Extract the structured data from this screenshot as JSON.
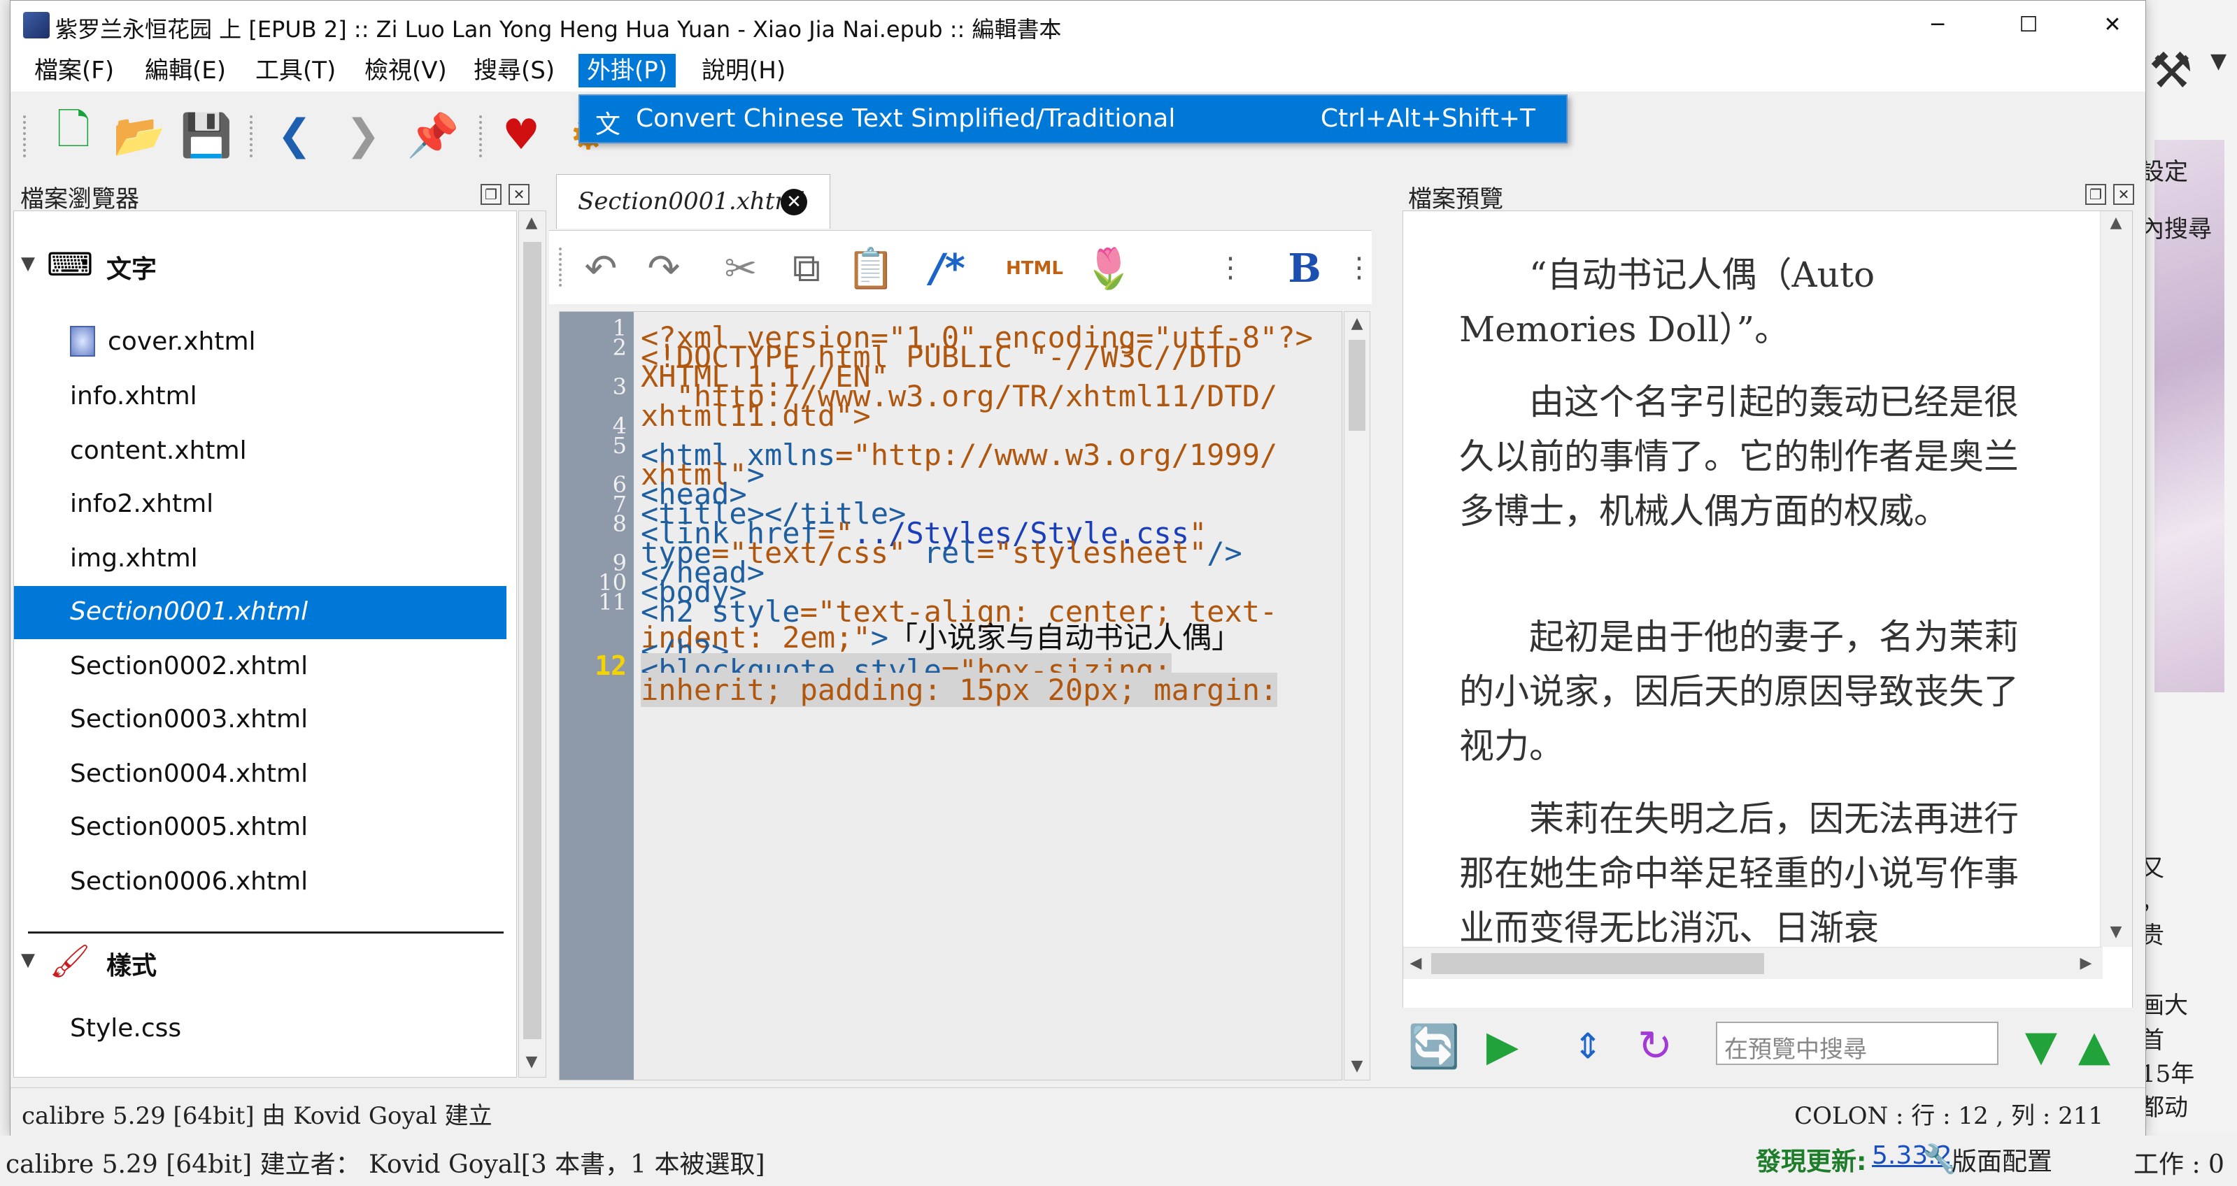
{
  "window": {
    "title": "紫罗兰永恒花园 上 [EPUB 2] :: Zi Luo Lan Yong Heng Hua Yuan - Xiao Jia Nai.epub :: 編輯書本",
    "minimize": "─",
    "maximize": "☐",
    "close": "✕"
  },
  "menu": [
    "檔案(F)",
    "編輯(E)",
    "工具(T)",
    "檢視(V)",
    "搜尋(S)",
    "外掛(P)",
    "說明(H)"
  ],
  "dropdown": {
    "icon": "文",
    "label": "Convert Chinese Text Simplified/Traditional",
    "shortcut": "Ctrl+Alt+Shift+T"
  },
  "toolbar_icons": [
    "new-file-icon",
    "open-folder-icon",
    "save-icon",
    "back-icon",
    "forward-icon",
    "pin-icon",
    "heart-icon",
    "settings-icon"
  ],
  "file_browser": {
    "title": "檔案瀏覽器",
    "sections": [
      {
        "label": "文字",
        "icon": "text-keyboard-icon"
      },
      {
        "label": "樣式",
        "icon": "paintbrush-icon"
      }
    ],
    "files": [
      "cover.xhtml",
      "info.xhtml",
      "content.xhtml",
      "info2.xhtml",
      "img.xhtml",
      "Section0001.xhtml",
      "Section0002.xhtml",
      "Section0003.xhtml",
      "Section0004.xhtml",
      "Section0005.xhtml",
      "Section0006.xhtml"
    ],
    "selected": "Section0001.xhtml",
    "styles": [
      "Style.css"
    ]
  },
  "editor": {
    "tab": "Section0001.xhtml",
    "line_numbers": [
      "1",
      "2",
      "3",
      "4",
      "5",
      "6",
      "7",
      "8",
      "9",
      "10",
      "11",
      "12"
    ],
    "current_line": "12"
  },
  "preview": {
    "title": "檔案預覽",
    "paragraphs": [
      "“自动书记人偶（Auto Memories Doll）”。",
      "由这个名字引起的轰动已经是很久以前的事情了。它的制作者是奥兰多博士，机械人偶方面的权威。",
      "起初是由于他的妻子，名为茉莉的小说家，因后天的原因导致丧失了视力。",
      "茉莉在失明之后，因无法再进行那在她生命中举足轻重的小说写作事业而变得无比消沉、日渐衰"
    ],
    "search_placeholder": "在預覽中搜尋"
  },
  "status": {
    "left": "calibre 5.29 [64bit] 由 Kovid Goyal 建立",
    "right": "COLON : 行 : 12 , 列 : 211"
  },
  "outer": {
    "left": "calibre 5.29 [64bit] 建立者： Kovid Goyal[3 本書，1 本被選取]",
    "update_label": "發現更新:",
    "version": "5.33.2",
    "layout": "版面配置",
    "jobs": "工作 : 0"
  },
  "background_app": {
    "settings": "設定",
    "search": "內搜尋",
    "fragments": [
      "又",
      "，",
      "贵",
      "画大",
      "首",
      "15年",
      "都动"
    ]
  }
}
